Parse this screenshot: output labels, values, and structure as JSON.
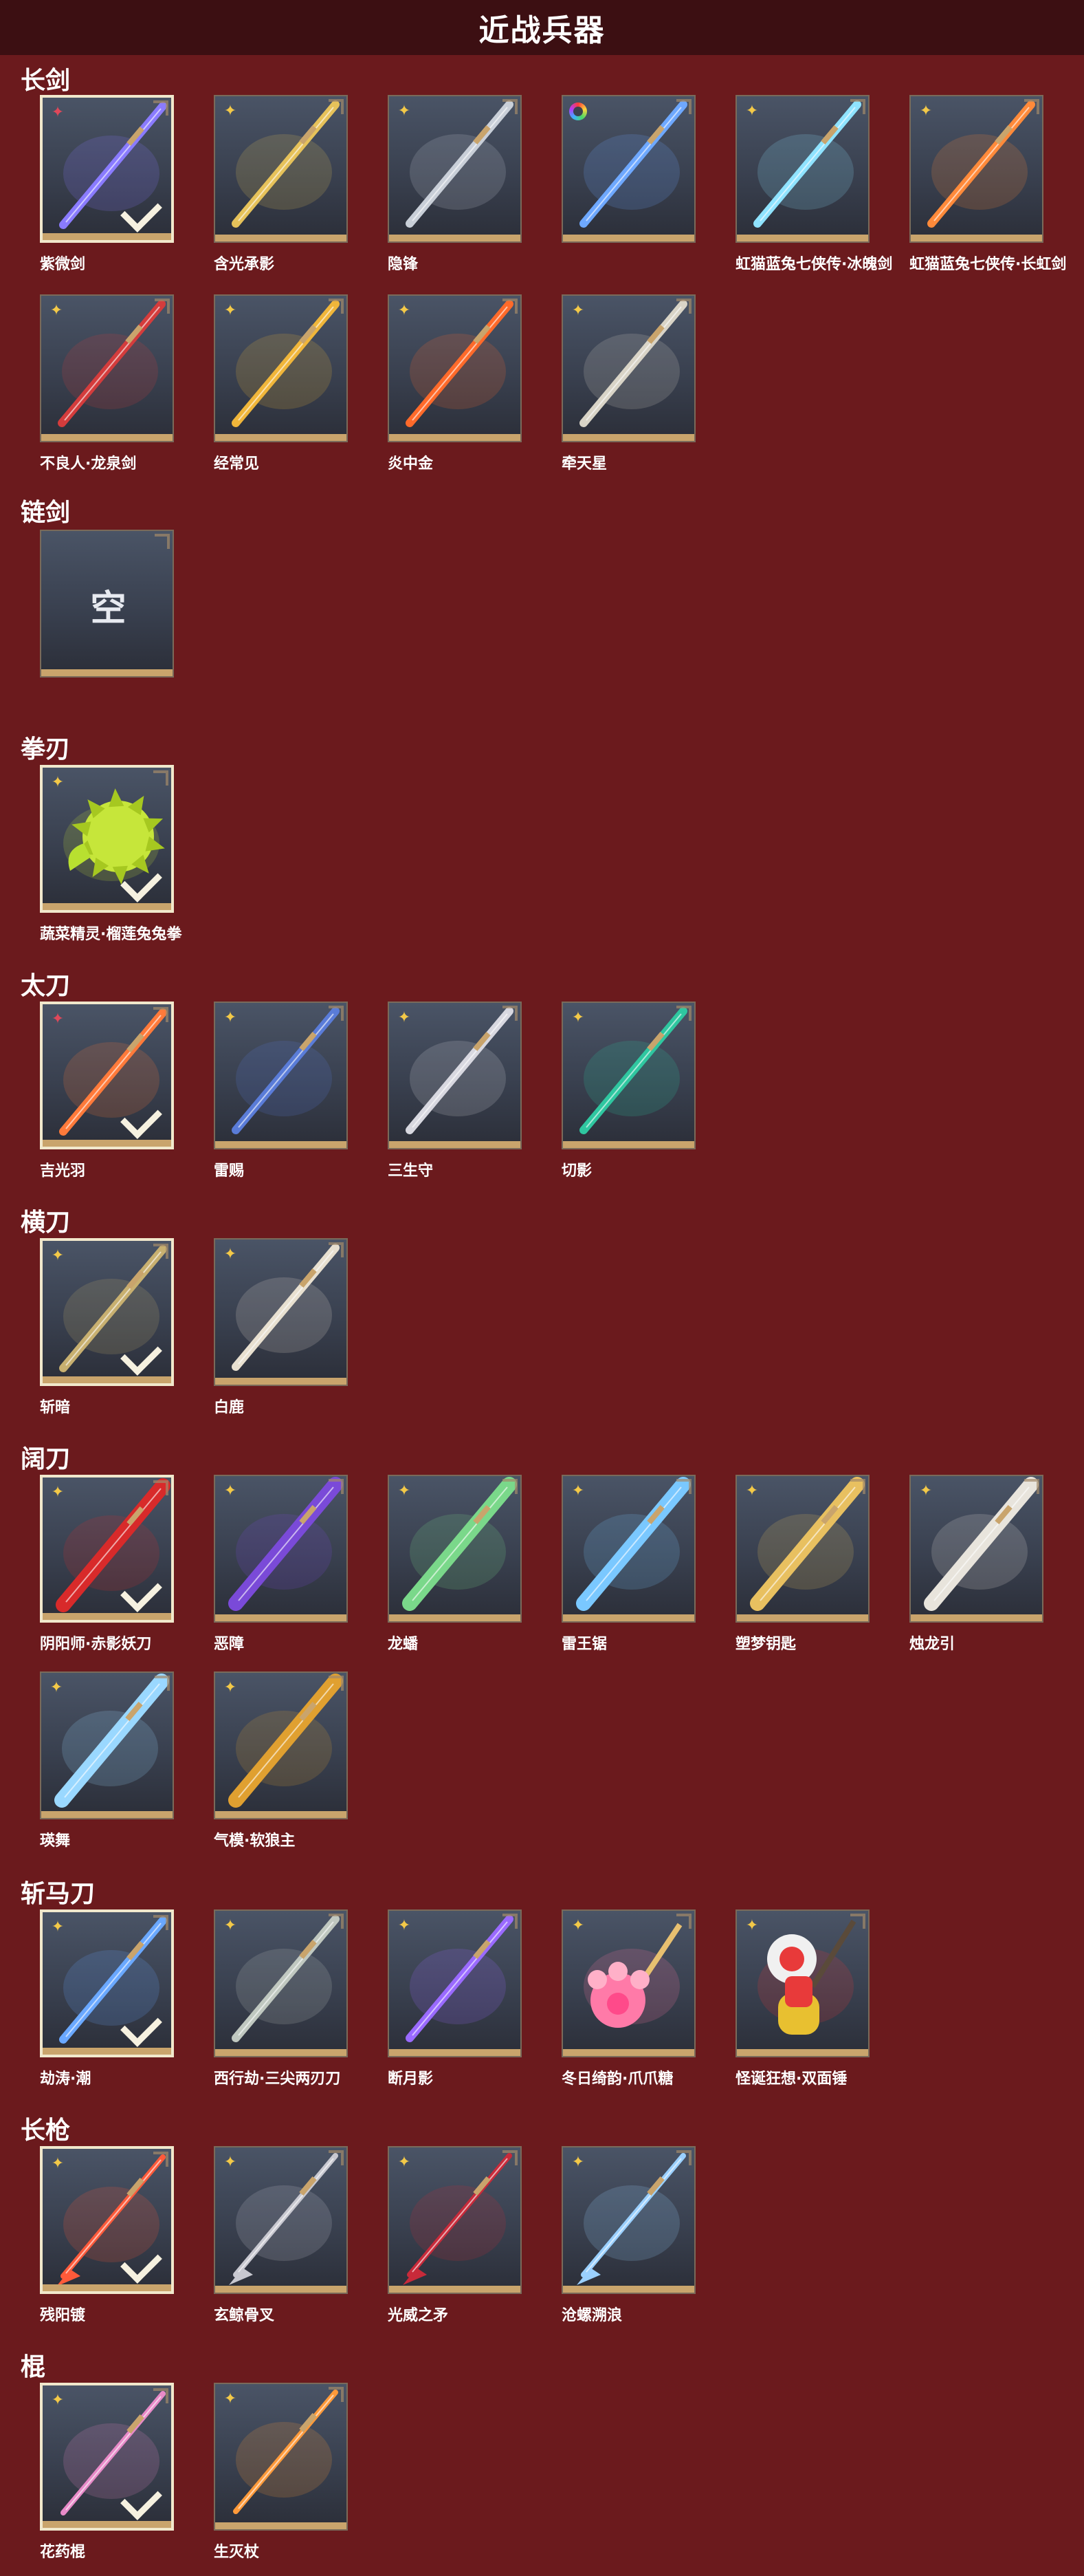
{
  "header": {
    "title": "近战兵器"
  },
  "categories": [
    {
      "title": "长剑",
      "items": [
        {
          "name": "紫微剑",
          "rarity": "red",
          "selected": true,
          "art": "blade-purple",
          "color": "#8a7bff"
        },
        {
          "name": "含光承影",
          "rarity": "gold",
          "selected": false,
          "art": "blade-gold",
          "color": "#e6c25a"
        },
        {
          "name": "隐锋",
          "rarity": "gold",
          "selected": false,
          "art": "blade-steel-red",
          "color": "#c9cfd8"
        },
        {
          "name": "",
          "rarity": "rainbow",
          "selected": false,
          "art": "blade-blue",
          "color": "#6ea8ff"
        },
        {
          "name": "虹猫蓝兔七侠传·冰魄剑",
          "rarity": "gold",
          "selected": false,
          "art": "blade-ice",
          "color": "#8fe3ff"
        },
        {
          "name": "虹猫蓝兔七侠传·长虹剑",
          "rarity": "gold",
          "selected": false,
          "art": "blade-orange",
          "color": "#ff8a3a"
        },
        {
          "name": "不良人·龙泉剑",
          "rarity": "gold",
          "selected": false,
          "art": "blade-dark-red",
          "color": "#d43c3c"
        },
        {
          "name": "经常见",
          "rarity": "gold",
          "selected": false,
          "art": "blade-gold-ornate",
          "color": "#f0b63a"
        },
        {
          "name": "炎中金",
          "rarity": "gold",
          "selected": false,
          "art": "blade-fire",
          "color": "#ff6a2a"
        },
        {
          "name": "牵天星",
          "rarity": "gold",
          "selected": false,
          "art": "blade-silver",
          "color": "#d9d4c7"
        }
      ]
    },
    {
      "title": "链剑",
      "items": [
        {
          "name": "",
          "rarity": "",
          "selected": false,
          "art": "empty",
          "empty_label": "空",
          "color": "#3c4250"
        }
      ]
    },
    {
      "title": "拳刃",
      "items": [
        {
          "name": "蔬菜精灵·榴莲兔兔拳",
          "rarity": "gold",
          "selected": true,
          "art": "fist-green",
          "color": "#c6e63a"
        }
      ]
    },
    {
      "title": "太刀",
      "items": [
        {
          "name": "吉光羽",
          "rarity": "red",
          "selected": true,
          "art": "katana-fire",
          "color": "#ff7a3a"
        },
        {
          "name": "雷赐",
          "rarity": "gold",
          "selected": false,
          "art": "katana-blue",
          "color": "#5a7cd8"
        },
        {
          "name": "三生守",
          "rarity": "gold",
          "selected": false,
          "art": "katana-silver",
          "color": "#d8d8e0"
        },
        {
          "name": "切影",
          "rarity": "gold",
          "selected": false,
          "art": "katana-teal",
          "color": "#2fc7a0"
        }
      ]
    },
    {
      "title": "横刀",
      "items": [
        {
          "name": "斩暗",
          "rarity": "gold",
          "selected": true,
          "art": "sabre-bronze",
          "color": "#c8b070"
        },
        {
          "name": "白鹿",
          "rarity": "gold",
          "selected": false,
          "art": "sabre-white",
          "color": "#e8e0d0"
        }
      ]
    },
    {
      "title": "阔刀",
      "items": [
        {
          "name": "阴阳师·赤影妖刀",
          "rarity": "gold",
          "selected": true,
          "art": "broad-red",
          "color": "#d82a2a"
        },
        {
          "name": "恶障",
          "rarity": "gold",
          "selected": false,
          "art": "broad-purple",
          "color": "#7a4ad8"
        },
        {
          "name": "龙蟠",
          "rarity": "gold",
          "selected": false,
          "art": "broad-green",
          "color": "#7ad88a"
        },
        {
          "name": "雷王锯",
          "rarity": "gold",
          "selected": false,
          "art": "broad-blue",
          "color": "#7ac8ff"
        },
        {
          "name": "塑梦钥匙",
          "rarity": "gold",
          "selected": false,
          "art": "broad-gold",
          "color": "#e8c060"
        },
        {
          "name": "烛龙引",
          "rarity": "gold",
          "selected": false,
          "art": "broad-white",
          "color": "#e8e4dc"
        },
        {
          "name": "瑛舞",
          "rarity": "gold",
          "selected": false,
          "art": "broad-glow",
          "color": "#9ad8ff"
        },
        {
          "name": "气模·软狼主",
          "rarity": "gold",
          "selected": false,
          "art": "broad-gold-red",
          "color": "#e0a030"
        }
      ]
    },
    {
      "title": "斩马刀",
      "items": [
        {
          "name": "劫涛·潮",
          "rarity": "gold",
          "selected": true,
          "art": "glaive-blue",
          "color": "#6aa8ff"
        },
        {
          "name": "西行劫·三尖两刃刀",
          "rarity": "gold",
          "selected": false,
          "art": "glaive-silver",
          "color": "#c0c8c0"
        },
        {
          "name": "断月影",
          "rarity": "gold",
          "selected": false,
          "art": "glaive-purple",
          "color": "#9a6aff"
        },
        {
          "name": "冬日绮韵·爪爪糖",
          "rarity": "gold",
          "selected": false,
          "art": "paw-pink",
          "color": "#ff7aa8"
        },
        {
          "name": "怪诞狂想·双面锤",
          "rarity": "gold",
          "selected": false,
          "art": "hammer-red",
          "color": "#e83a3a"
        }
      ]
    },
    {
      "title": "长枪",
      "items": [
        {
          "name": "残阳镀",
          "rarity": "gold",
          "selected": true,
          "art": "spear-red",
          "color": "#ff5a3a"
        },
        {
          "name": "玄鲸骨叉",
          "rarity": "gold",
          "selected": false,
          "art": "spear-silver",
          "color": "#c8c8d0"
        },
        {
          "name": "光威之矛",
          "rarity": "gold",
          "selected": false,
          "art": "spear-crimson",
          "color": "#c82a3a"
        },
        {
          "name": "沧螺溯浪",
          "rarity": "gold",
          "selected": false,
          "art": "spear-ice",
          "color": "#9ad0ff"
        }
      ]
    },
    {
      "title": "棍",
      "items": [
        {
          "name": "花药棍",
          "rarity": "gold",
          "selected": true,
          "art": "staff-flower",
          "color": "#e88ac8"
        },
        {
          "name": "生灭杖",
          "rarity": "gold",
          "selected": false,
          "art": "staff-rainbow",
          "color": "#ff9a3a"
        }
      ]
    }
  ]
}
